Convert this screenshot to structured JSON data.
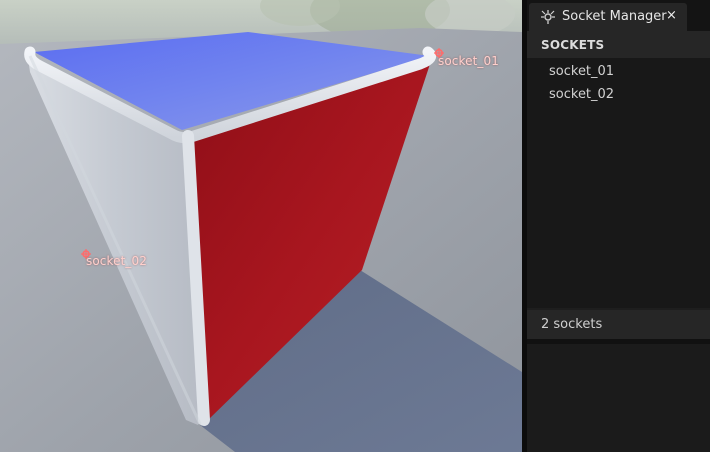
{
  "viewport": {
    "sockets": [
      {
        "label": "socket_01"
      },
      {
        "label": "socket_02"
      }
    ],
    "colors": {
      "cube_top": "#6f82ec",
      "cube_right": "#a81620",
      "cube_left": "#c4c9d2",
      "floor": "#8a8f98",
      "socket_marker": "#ff6b6b"
    }
  },
  "panel": {
    "tab": {
      "title": "Socket Manager",
      "close_glyph": "×",
      "icon": "socket-manager-icon"
    },
    "section_title": "SOCKETS",
    "sockets": [
      {
        "name": "socket_01"
      },
      {
        "name": "socket_02"
      }
    ],
    "status": "2 sockets"
  }
}
